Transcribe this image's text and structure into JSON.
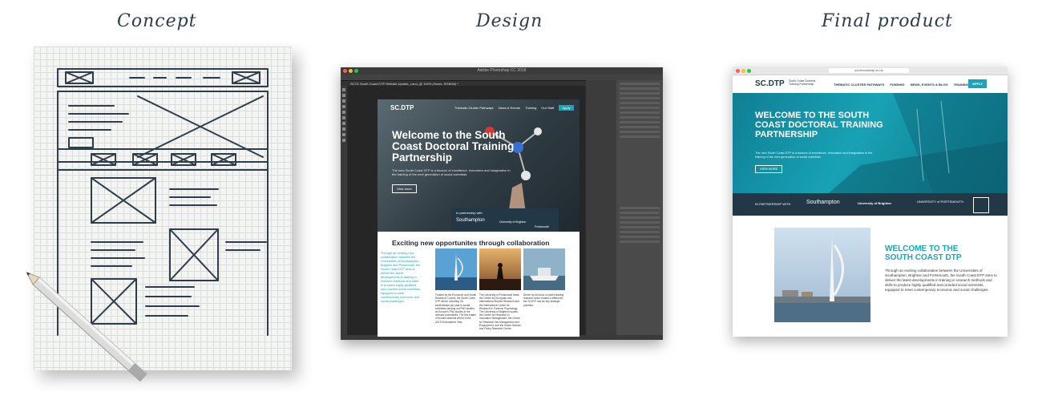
{
  "headings": {
    "concept": "Concept",
    "design": "Design",
    "final": "Final product"
  },
  "design": {
    "window_title": "Adobe Photoshop CC 2018",
    "tab_label": "SCTD South Coast DTP Website Update_Land_@ 100% (Home, RGB/8#) *",
    "page": {
      "logo": "SC.DTP",
      "nav": [
        "Thematic Cluster Pathways",
        "News & Events",
        "Training",
        "Our Staff",
        "Apply"
      ],
      "hero_title": "Welcome to the South Coast Doctoral Training Partnership",
      "hero_text": "The new South Coast DTP is a beacon of excellence, innovation and imagination in the training of the next generation of social scientists.",
      "hero_button": "View more",
      "partnership_label": "In partnership with",
      "partner_southampton": "Southampton",
      "partner_brighton": "University of Brighton",
      "partner_portsmouth": "Portsmouth",
      "section_title": "Exciting new opportunites through collaboration",
      "intro": "Through an exciting new collaboration between the Universities of Southampton, Brighton and Portsmouth, the South Coast DTP aims to deliver the latest developments in training in research methods and skills to produce highly qualified and rounded social scientists, equipped to meet contemporary economic and social challenges.",
      "col1": "Funded by the Economic and Social Research Council, the South Coast DTP will be recruiting 28 studentships per year to social scientists carrying out PhD studies, as Europe's PhD studies in the relevant universities. The first intake of funded students will be in the 2017/18 Academic Year.",
      "col2": "The University of Portsmouth leads the Centre for European and International Studies Research and the international Centre for Research in Forensic Psychology. The University of Brighton houses the Centre for Research in Innovation Management, the Centre for Research into Management and Employment, and the Social Science and Policy Research Centre.",
      "col3": "Driven by its focus on world leading research which makes a difference, the SCDTP has six key strategic priorities:"
    }
  },
  "final": {
    "url": "southcoastdtp.ac.uk",
    "logo": "SC.DTP",
    "logo_sub": "South Coast Doctoral Training Partnership",
    "nav": [
      "THEMATIC CLUSTER PATHWAYS",
      "FUNDING",
      "NEWS, EVENTS & BLOG",
      "TRAINING",
      "STAFF"
    ],
    "apply": "APPLY",
    "hero_title": "WELCOME TO THE SOUTH COAST DOCTORAL TRAINING PARTNERSHIP",
    "hero_text": "The new South Coast DTP is a beacon of excellence, innovation and imagination in the training of the next generation of social scientists",
    "hero_button": "VIEW MORE",
    "partnership_label": "IN PARTNERSHIP WITH",
    "partner_southampton": "Southampton",
    "partner_brighton": "University of Brighton",
    "partner_portsmouth": "UNIVERSITY of PORTSMOUTH",
    "welcome_title": "WELCOME TO THE SOUTH COAST DTP",
    "welcome_text": "Through an exciting collaboration between the Universities of Southampton, Brighton and Portsmouth, the South Coast DTP aims to deliver the latest developments in training in research methods and skills to produce highly qualified and rounded social scientists, equipped to meet contemporary economic and social challenges."
  },
  "colors": {
    "teal": "#1aa6b7",
    "navy": "#223847",
    "ink": "#2f3d4a"
  }
}
